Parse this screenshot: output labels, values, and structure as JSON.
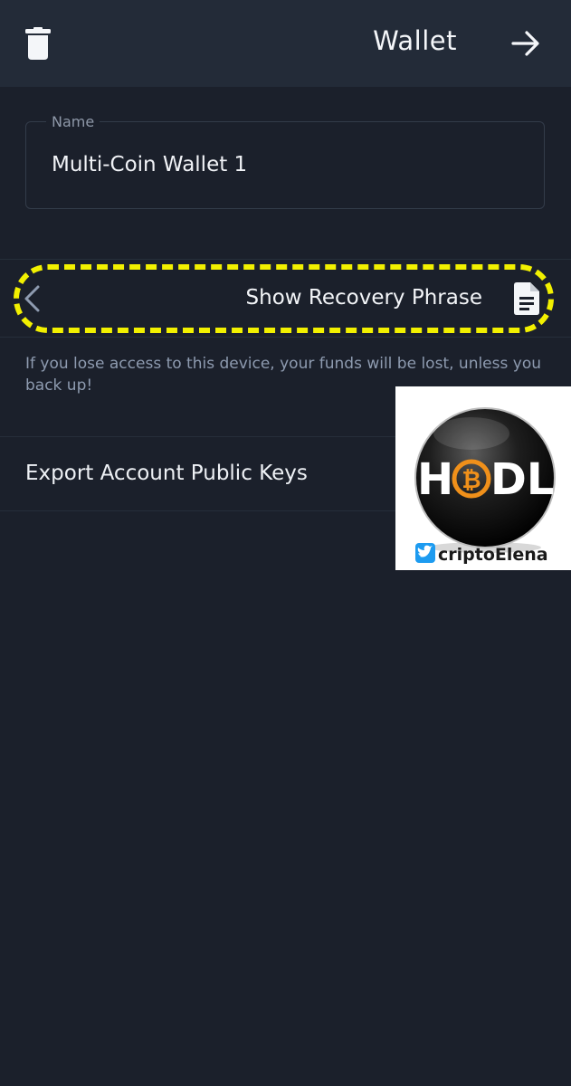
{
  "header": {
    "title": "Wallet"
  },
  "name_field": {
    "label": "Name",
    "value": "Multi-Coin Wallet 1"
  },
  "recovery": {
    "label": "Show Recovery Phrase",
    "highlight_color": "#f2f000"
  },
  "warning": {
    "text": "If you lose access to this device, your funds will be lost, unless you back up!"
  },
  "export": {
    "label": "Export Account Public Keys"
  },
  "overlay_logo": {
    "logo_text": "HODL",
    "handle": "criptoElena",
    "icon": "twitter-bird-icon",
    "accent_color": "#f0901a"
  },
  "colors": {
    "background": "#1b202b",
    "header": "#232b38",
    "muted_text": "#8e9bb0"
  }
}
